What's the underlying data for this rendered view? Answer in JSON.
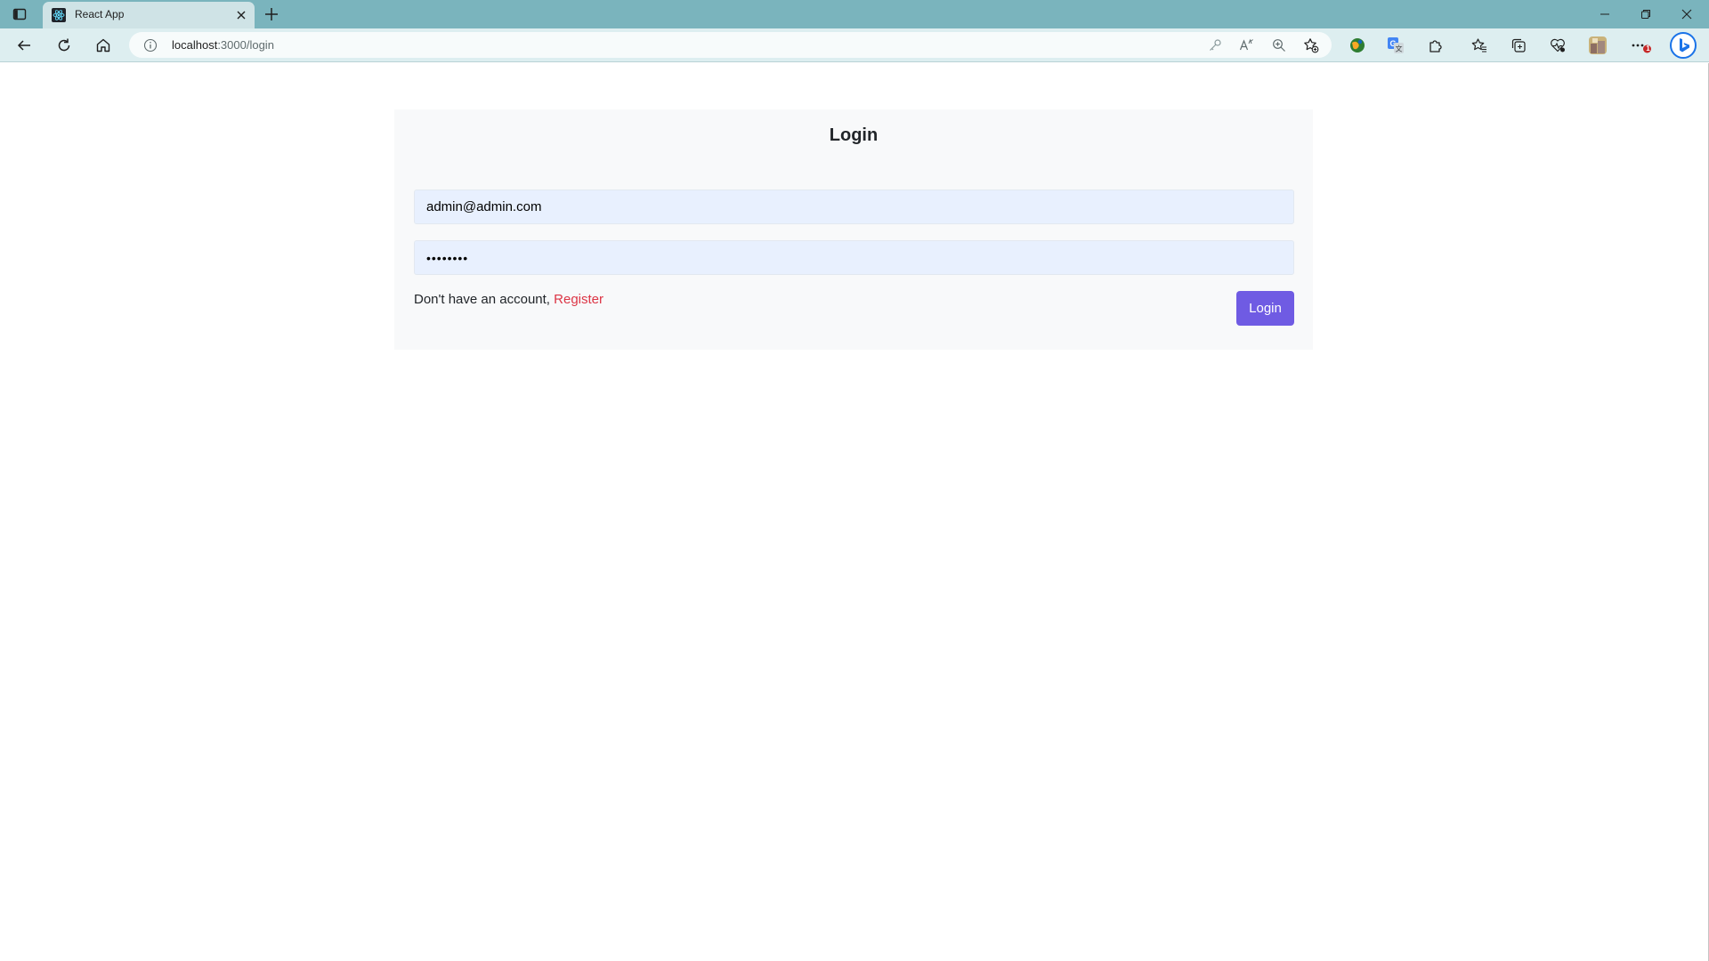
{
  "browser": {
    "tab": {
      "title": "React App"
    },
    "address": {
      "host": "localhost",
      "path": ":3000/login"
    },
    "notification_count": "1",
    "icons": {
      "tab_actions": "tab-actions-icon",
      "favicon": "react-logo-icon",
      "close_tab": "close-icon",
      "new_tab": "plus-icon",
      "back": "arrow-left-icon",
      "refresh": "refresh-icon",
      "home": "home-icon",
      "site_info": "info-icon",
      "password_key": "key-icon",
      "read_aloud": "read-aloud-icon",
      "zoom": "zoom-icon",
      "add_favorite": "star-plus-icon",
      "extensions": "puzzle-icon",
      "favorites": "favorites-icon",
      "collections": "collections-icon",
      "performance": "heart-pulse-icon",
      "profile": "avatar",
      "settings": "more-icon",
      "copilot": "bing-icon"
    }
  },
  "login": {
    "title": "Login",
    "email_value": "admin@admin.com",
    "password_mask": "••••••••",
    "no_account_text": "Don't have an account,",
    "register_link": "Register",
    "submit_label": "Login"
  },
  "colors": {
    "tabstrip": "#7ab4bd",
    "toolbar": "#ddeef0",
    "card_bg": "#f8f9fa",
    "input_bg": "#e8f0fe",
    "register_link": "#dc3545",
    "login_button": "#6f5be3"
  }
}
